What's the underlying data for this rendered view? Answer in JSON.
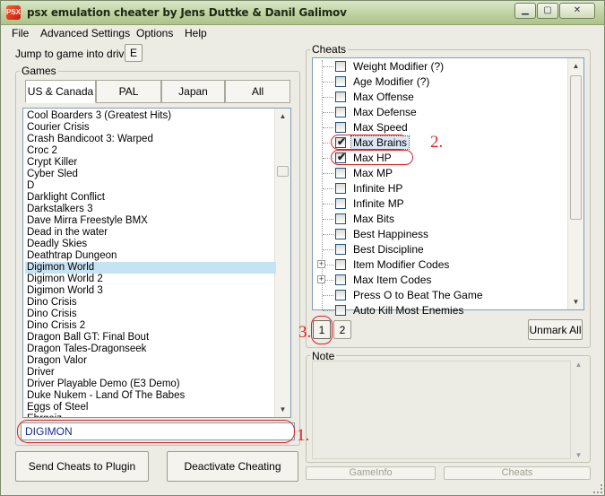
{
  "window": {
    "title": "psx emulation cheater by Jens Duttke & Danil Galimov",
    "app_icon": "psx-app-icon",
    "app_icon_text": "PSX"
  },
  "menu": [
    "File",
    "Advanced Settings",
    "Options",
    "Help"
  ],
  "drive": {
    "label": "Jump to game into drive",
    "value": "E"
  },
  "games": {
    "title": "Games",
    "tabs": [
      "US & Canada",
      "PAL",
      "Japan",
      "All"
    ],
    "active_tab": 0,
    "items": [
      "Cool Boarders 3 (Greatest Hits)",
      "Courier Crisis",
      "Crash Bandicoot 3: Warped",
      "Croc 2",
      "Crypt Killer",
      "Cyber Sled",
      "D",
      "Darklight Conflict",
      "Darkstalkers 3",
      "Dave Mirra Freestyle BMX",
      "Dead in the water",
      "Deadly Skies",
      "Deathtrap Dungeon",
      "Digimon World",
      "Digimon World 2",
      "Digimon World 3",
      "Dino Crisis",
      "Dino Crisis",
      "Dino Crisis 2",
      "Dragon Ball GT: Final Bout",
      "Dragon Tales-Dragonseek",
      "Dragon Valor",
      "Driver",
      "Driver Playable Demo (E3 Demo)",
      "Duke Nukem - Land Of The Babes",
      "Eggs of Steel",
      "Ehrgeiz"
    ],
    "selected_index": 13,
    "search_value": "DIGIMON"
  },
  "cheats": {
    "title": "Cheats",
    "items": [
      {
        "label": "Weight Modifier   (?)",
        "checked": false,
        "expandable": false
      },
      {
        "label": "Age Modifier   (?)",
        "checked": false,
        "expandable": false
      },
      {
        "label": "Max Offense",
        "checked": false,
        "expandable": false
      },
      {
        "label": "Max Defense",
        "checked": false,
        "expandable": false
      },
      {
        "label": "Max Speed",
        "checked": false,
        "expandable": false
      },
      {
        "label": "Max Brains",
        "checked": true,
        "expandable": false
      },
      {
        "label": "Max HP",
        "checked": true,
        "expandable": false
      },
      {
        "label": "Max MP",
        "checked": false,
        "expandable": false
      },
      {
        "label": "Infinite HP",
        "checked": false,
        "expandable": false
      },
      {
        "label": "Infinite MP",
        "checked": false,
        "expandable": false
      },
      {
        "label": "Max Bits",
        "checked": false,
        "expandable": false
      },
      {
        "label": "Best Happiness",
        "checked": false,
        "expandable": false
      },
      {
        "label": "Best Discipline",
        "checked": false,
        "expandable": false
      },
      {
        "label": "Item Modifier Codes",
        "checked": false,
        "expandable": true
      },
      {
        "label": "Max Item Codes",
        "checked": false,
        "expandable": true
      },
      {
        "label": "Press O to Beat The Game",
        "checked": false,
        "expandable": false
      },
      {
        "label": "Auto Kill Most Enemies",
        "checked": false,
        "expandable": false
      }
    ],
    "pages": [
      "1",
      "2"
    ],
    "active_page": 0,
    "unmark_all_label": "Unmark All"
  },
  "note": {
    "title": "Note",
    "text": ""
  },
  "buttons": {
    "send": "Send Cheats to Plugin",
    "deactivate": "Deactivate Cheating",
    "gameinfo": "GameInfo",
    "cheats_tab": "Cheats"
  },
  "annotations": [
    "1.",
    "2.",
    "3."
  ],
  "colors": {
    "annotation_red": "#dd2222",
    "selection": "#c6e3f5",
    "search_text": "#1a2b8a"
  }
}
